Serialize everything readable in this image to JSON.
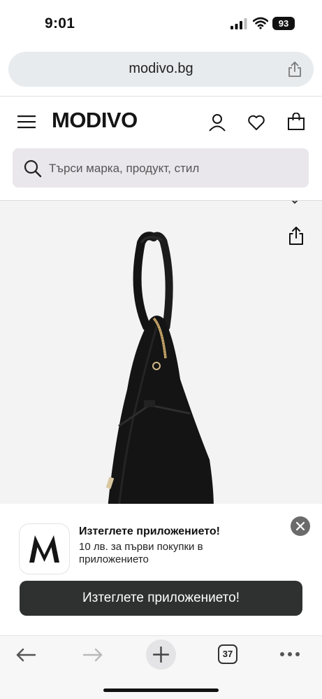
{
  "status_bar": {
    "time": "9:01",
    "battery": "93"
  },
  "address_bar": {
    "url": "modivo.bg"
  },
  "header": {
    "logo": "MODIVO"
  },
  "search": {
    "placeholder": "Търси марка, продукт, стил"
  },
  "app_banner": {
    "title": "Изтеглете приложението!",
    "subtitle": "10 лв. за първи покупки в приложението",
    "button_label": "Изтеглете приложението!"
  },
  "toolbar": {
    "tab_count": "37"
  },
  "icons": {
    "menu": "menu-icon",
    "account": "user-icon",
    "favorites": "heart-icon",
    "cart": "bag-icon",
    "search": "search-icon",
    "share": "share-icon",
    "close": "close-icon",
    "back": "back-arrow-icon",
    "forward": "forward-arrow-icon",
    "new_tab": "plus-icon",
    "more": "more-icon"
  },
  "colors": {
    "search_bg": "#e9e6ec",
    "button_bg": "#2f3030",
    "product_bg": "#f3f3f3"
  }
}
